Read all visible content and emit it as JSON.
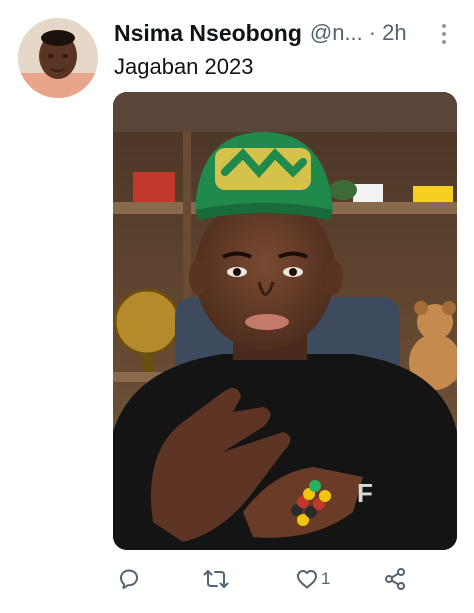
{
  "tweet": {
    "author_name": "Nsima Nseobong",
    "author_handle": "@n...",
    "separator": "·",
    "time": "2h",
    "text": "Jagaban 2023"
  },
  "actions": {
    "like_count": "1"
  },
  "icons": [
    "more-vertical-icon",
    "reply-icon",
    "retweet-icon",
    "like-icon",
    "share-icon"
  ],
  "colors": {
    "text": "#0f1419",
    "secondary": "#536471",
    "icon": "#536471"
  }
}
